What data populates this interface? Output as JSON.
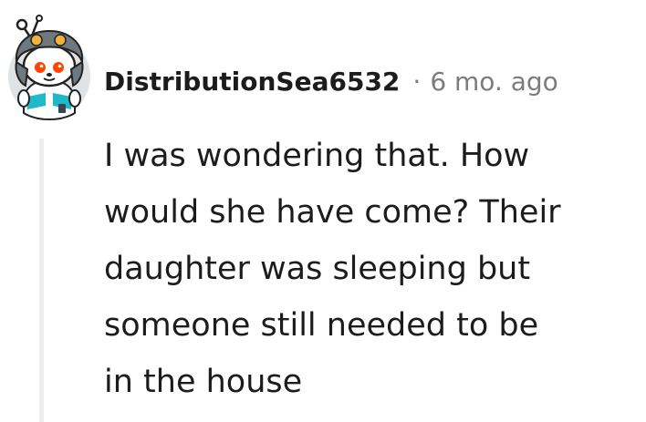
{
  "comment": {
    "author": "DistributionSea6532",
    "separator": "·",
    "timestamp": "6 mo. ago",
    "avatar": "reddit-snoo-avatar",
    "body_lines": [
      "I was wondering that. How",
      "would she have come? Their",
      "daughter was sleeping but",
      "someone still needed to be",
      "in the house"
    ]
  },
  "colors": {
    "text": "#1c1c1c",
    "meta": "#7c7c7c",
    "thread_line": "#ededed",
    "avatar_background": "#dfe3e6",
    "avatar_hat": "#6f787f",
    "avatar_accent": "#ff4500",
    "avatar_shirt": "#20b9c9"
  }
}
